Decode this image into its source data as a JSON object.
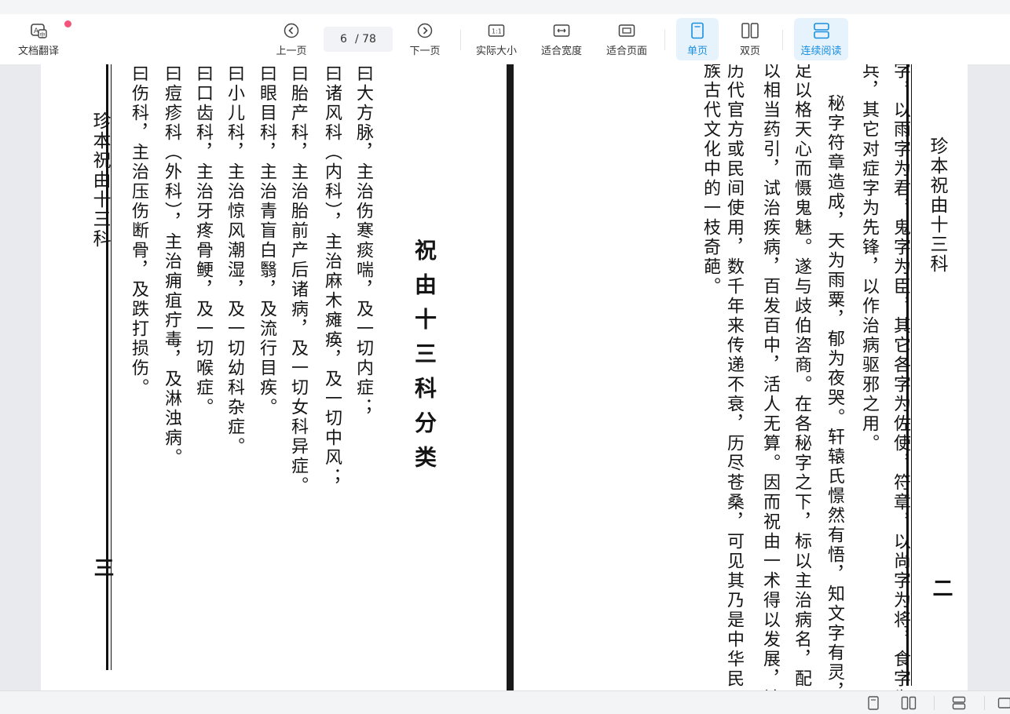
{
  "toolbar": {
    "translate_label": "文档翻译",
    "prev_label": "上一页",
    "page_current": "6",
    "page_total": "/ 78",
    "next_label": "下一页",
    "actual_size_label": "实际大小",
    "fit_width_label": "适合宽度",
    "fit_page_label": "适合页面",
    "single_page_label": "单页",
    "double_page_label": "双页",
    "continuous_label": "连续阅读",
    "accent_color": "#1a8fe0",
    "notify_color": "#f4547a"
  },
  "left_page": {
    "header": "珍本祝由十三科",
    "page_number": "三",
    "heading": "祝由十三科分类",
    "columns": [
      "曰大方脉，主治伤寒痰喘，及一切内症；",
      "曰诸风科（内科），主治麻木瘫痪，及一切中风；",
      "曰胎产科，主治胎前产后诸病，及一切女科异症。",
      "曰眼目科，主治青盲白翳，及流行目疾。",
      "曰小儿科，主治惊风潮湿，及一切幼科杂症。",
      "曰口齿科，主治牙疼骨鲠，及一切喉症。",
      "曰痘疹科（外科），主治痈疽疔毒，及淋浊病。",
      "曰伤科，主治压伤断骨，及跌打损伤。"
    ]
  },
  "right_page": {
    "header": "珍本祝由十三科",
    "page_number": "二",
    "columns": [
      "字，以雨字为君，鬼字为臣，其它各字为佐使，符章，以尚字为将，食字为",
      "兵，其它对症字为先锋，以作治病驱邪之用。",
      "秘字符章造成，天为雨粟，郁为夜哭。轩辕氏憬然有悟，知文字有灵，",
      "足以格天心而慑鬼魅。遂与歧伯咨商。在各秘字之下，标以主治病名，配",
      "以相当药引，试治疾病，百发百中，活人无算。因而祝由一术得以发展，被",
      "历代官方或民间使用，数千年来传递不衰，历尽苍桑，可见其乃是中华民",
      "族古代文化中的一枝奇葩。"
    ]
  },
  "statusbar": {
    "icons": [
      "single-page-icon",
      "double-page-icon",
      "continuous-icon",
      "fit-icon"
    ]
  }
}
